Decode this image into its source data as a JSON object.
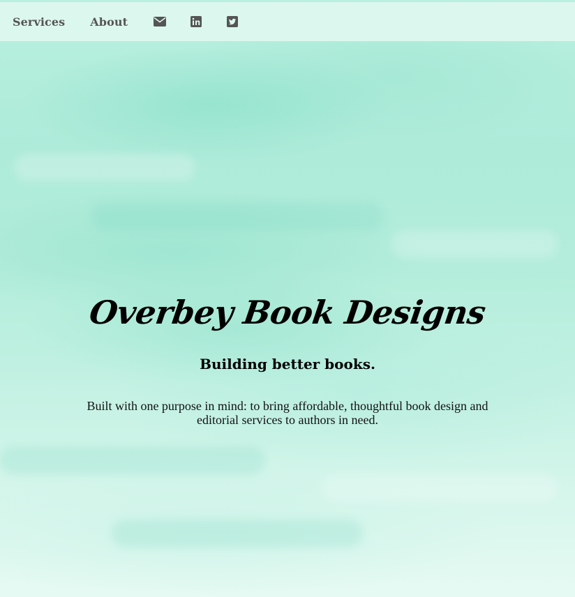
{
  "nav": {
    "items": [
      {
        "label": "Services"
      },
      {
        "label": "About"
      }
    ],
    "icons": [
      {
        "name": "email-icon"
      },
      {
        "name": "linkedin-icon"
      },
      {
        "name": "twitter-icon"
      }
    ],
    "link_color": "#555555"
  },
  "hero": {
    "title": "Overbey Book Designs",
    "tagline": "Building better books.",
    "description": "Built with one purpose in mind: to bring affordable, thoughtful book design and editorial services to authors in need."
  },
  "colors": {
    "background_accent": "#b8efde",
    "text": "#000000"
  }
}
